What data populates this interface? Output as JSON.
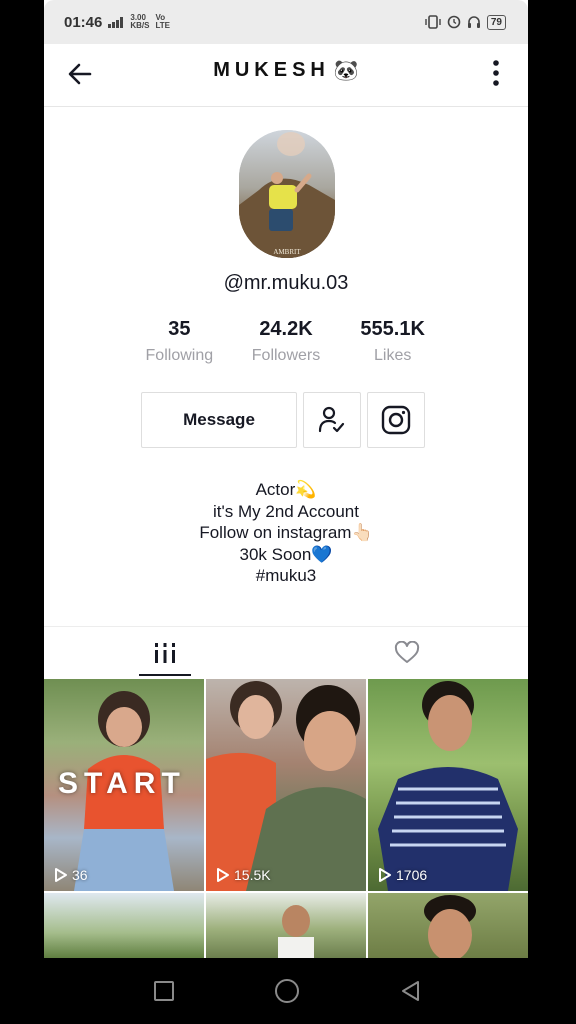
{
  "status_bar": {
    "time": "01:46",
    "net_speed": "3.00",
    "net_unit": "KB/S",
    "net_type": "Vo LTE",
    "battery": "79"
  },
  "header": {
    "title": "MUKESH",
    "title_emoji": "🐼",
    "back_icon": "arrow-left-icon",
    "more_icon": "more-vertical-icon"
  },
  "profile": {
    "username": "@mr.muku.03",
    "avatar_caption": "AMBRIT"
  },
  "stats": [
    {
      "value": "35",
      "label": "Following"
    },
    {
      "value": "24.2K",
      "label": "Followers"
    },
    {
      "value": "555.1K",
      "label": "Likes"
    }
  ],
  "actions": {
    "message_label": "Message",
    "follow_icon": "user-check-icon",
    "instagram_icon": "instagram-icon"
  },
  "bio": {
    "lines": [
      "Actor💫",
      "it's My 2nd Account",
      "Follow on instagram👆🏻",
      "30k Soon💙",
      "#muku3"
    ]
  },
  "tabs": {
    "videos_icon": "grid-icon",
    "liked_icon": "heart-icon"
  },
  "videos": [
    {
      "views": "36",
      "overlay_text": "START"
    },
    {
      "views": "15.5K"
    },
    {
      "views": "1706"
    }
  ],
  "colors": {
    "text_primary": "#161823",
    "text_secondary": "#a0a0a6",
    "border": "#dedede"
  }
}
